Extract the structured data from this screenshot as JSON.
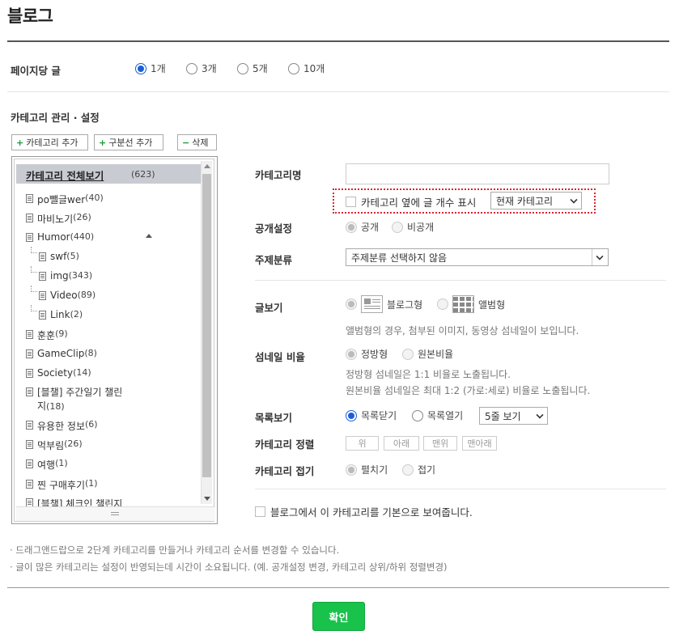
{
  "page": {
    "title": "블로그"
  },
  "posts_per_page": {
    "label": "페이지당 글",
    "options": [
      "1개",
      "3개",
      "5개",
      "10개"
    ],
    "selected": "1개"
  },
  "category": {
    "section_title": "카테고리 관리 · 설정",
    "toolbar": {
      "add_category": "카테고리 추가",
      "add_divider": "구분선 추가",
      "delete": "삭제"
    },
    "tree": {
      "root_label": "카테고리 전체보기",
      "root_count": "(623)",
      "items": [
        {
          "name": "po뺄글wer",
          "count": "(40)"
        },
        {
          "name": "마비노기",
          "count": "(26)"
        },
        {
          "name": "Humor",
          "count": "(440)"
        },
        {
          "name": "swf",
          "count": "(5)"
        },
        {
          "name": "img",
          "count": "(343)"
        },
        {
          "name": "Video",
          "count": "(89)"
        },
        {
          "name": "Link",
          "count": "(2)"
        },
        {
          "name": "훈훈",
          "count": "(9)"
        },
        {
          "name": "GameClip",
          "count": "(8)"
        },
        {
          "name": "Society",
          "count": "(14)"
        },
        {
          "name": "[블챌] 주간일기 챌린",
          "name2": "지",
          "count": "(18)"
        },
        {
          "name": "유용한 정보",
          "count": "(6)"
        },
        {
          "name": "먹부림",
          "count": "(26)"
        },
        {
          "name": "여행",
          "count": "(1)"
        },
        {
          "name": "찐 구매후기",
          "count": "(1)"
        },
        {
          "name": "[블챌] 체크인 챌린지",
          "count": ""
        }
      ]
    }
  },
  "settings": {
    "name_label": "카테고리명",
    "name_value": "",
    "show_count_label": "카테고리 옆에 글 개수 표시",
    "show_count_select": "현재 카테고리",
    "visibility_label": "공개설정",
    "visibility_options": [
      "공개",
      "비공개"
    ],
    "topic_label": "주제분류",
    "topic_select": "주제분류 선택하지 않음",
    "view_label": "글보기",
    "view_blog": "블로그형",
    "view_album": "앨범형",
    "view_note": "앨범형의 경우, 첨부된 이미지, 동영상 섬네일이 보입니다.",
    "thumb_label": "섬네일 비율",
    "thumb_options": [
      "정방형",
      "원본비율"
    ],
    "thumb_note1": "정방형 섬네일은 1:1 비율로 노출됩니다.",
    "thumb_note2": "원본비율 섬네일은 최대 1:2 (가로:세로) 비율로 노출됩니다.",
    "list_label": "목록보기",
    "list_options": [
      "목록닫기",
      "목록열기"
    ],
    "list_select": "5줄 보기",
    "sort_label": "카테고리 정렬",
    "sort_buttons": [
      "위",
      "아래",
      "맨위",
      "맨아래"
    ],
    "fold_label": "카테고리 접기",
    "fold_options": [
      "펼치기",
      "접기"
    ],
    "default_label": "블로그에서 이 카테고리를 기본으로 보여줍니다."
  },
  "notes": [
    "· 드래그앤드랍으로 2단계 카테고리를 만들거나 카테고리 순서를 변경할 수 있습니다.",
    "· 글이 많은 카테고리는 설정이 반영되는데 시간이 소요됩니다. (예. 공개설정 변경, 카테고리 상위/하위 정렬변경)"
  ],
  "confirm_label": "확인",
  "colors": {
    "accent": "#1a5fd8",
    "confirm": "#19c24b",
    "highlight": "#d9262e"
  }
}
